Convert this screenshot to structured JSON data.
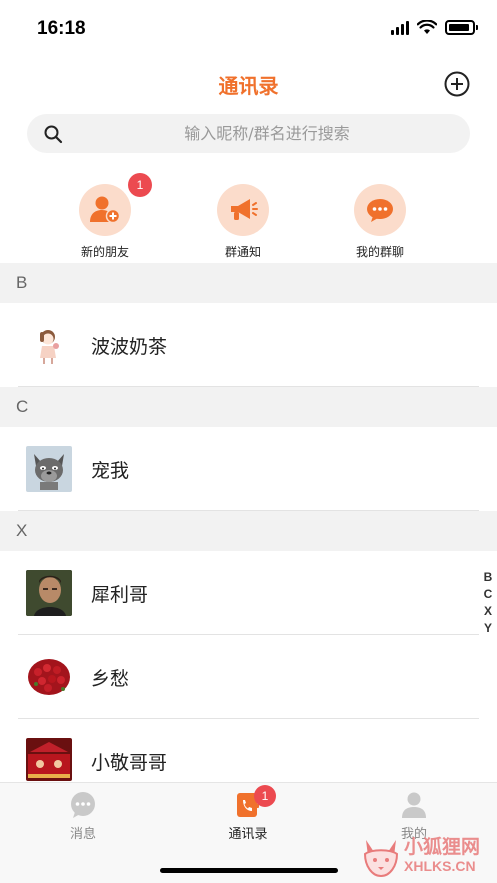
{
  "status_bar": {
    "time": "16:18",
    "battery_level": 0.9
  },
  "header": {
    "title": "通讯录",
    "add_icon": "plus-circle-icon"
  },
  "search": {
    "placeholder": "输入昵称/群名进行搜索",
    "value": ""
  },
  "quick_actions": [
    {
      "label": "新的朋友",
      "icon": "add-friend-icon",
      "badge": "1"
    },
    {
      "label": "群通知",
      "icon": "megaphone-icon"
    },
    {
      "label": "我的群聊",
      "icon": "group-chat-icon"
    }
  ],
  "contacts": {
    "sections": [
      {
        "letter": "B",
        "items": [
          {
            "name": "波波奶茶"
          }
        ]
      },
      {
        "letter": "C",
        "items": [
          {
            "name": "宠我"
          }
        ]
      },
      {
        "letter": "X",
        "items": [
          {
            "name": "犀利哥"
          },
          {
            "name": "乡愁"
          },
          {
            "name": "小敬哥哥"
          }
        ]
      }
    ]
  },
  "alpha_index": [
    "B",
    "C",
    "X",
    "Y"
  ],
  "tab_bar": {
    "tabs": [
      {
        "label": "消息",
        "icon": "chat-bubble-icon",
        "active": false
      },
      {
        "label": "通讯录",
        "icon": "contacts-book-icon",
        "active": true,
        "badge": "1"
      },
      {
        "label": "我的",
        "icon": "person-icon",
        "active": false
      }
    ]
  },
  "watermark": {
    "line1": "小狐狸网",
    "line2": "XHLKS.CN"
  },
  "colors": {
    "accent": "#f0712c",
    "badge": "#ec4a50",
    "icon_bg": "#fbdccb",
    "section_bg": "#f2f2f2"
  }
}
